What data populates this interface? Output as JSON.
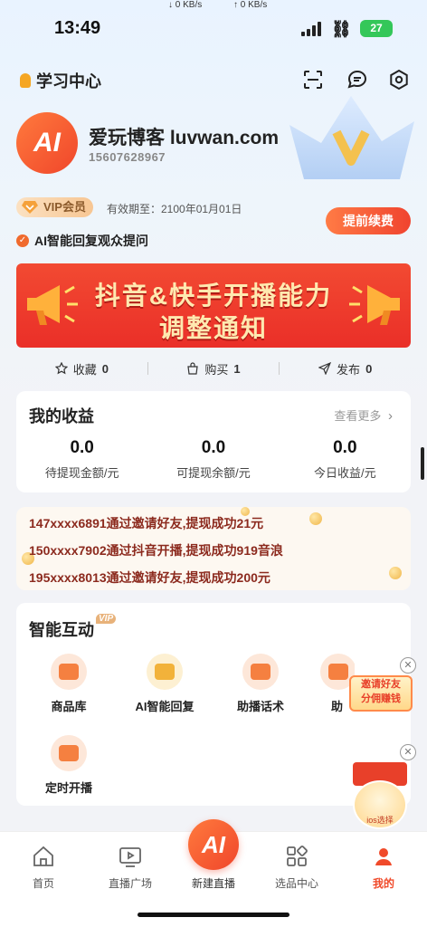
{
  "status_bar": {
    "time": "13:49",
    "down_speed": "↓ 0 KB/s",
    "up_speed": "↑ 0 KB/s",
    "battery": "27"
  },
  "header": {
    "title": "学习中心",
    "icons": [
      "scan-icon",
      "message-icon",
      "settings-icon"
    ]
  },
  "profile": {
    "avatar_text": "AI",
    "name": "爱玩博客 luvwan.com",
    "phone": "15607628967",
    "vip_label": "VIP会员",
    "vip_expiry": "有效期至：2100年01月01日",
    "renew_label": "提前续费",
    "ai_reply": "AI智能回复观众提问"
  },
  "banner": {
    "line1": "抖音&快手开播能力",
    "line2": "调整通知"
  },
  "stats": [
    {
      "label": "收藏",
      "value": "0",
      "icon": "star-icon"
    },
    {
      "label": "购买",
      "value": "1",
      "icon": "bag-icon"
    },
    {
      "label": "发布",
      "value": "0",
      "icon": "send-icon"
    }
  ],
  "earnings": {
    "title": "我的收益",
    "more": "查看更多",
    "items": [
      {
        "value": "0.0",
        "label": "待提现金额/元"
      },
      {
        "value": "0.0",
        "label": "可提现余额/元"
      },
      {
        "value": "0.0",
        "label": "今日收益/元"
      }
    ]
  },
  "ticker": [
    "147xxxx6891通过邀请好友,提现成功21元",
    "150xxxx7902通过抖音开播,提现成功919音浪",
    "195xxxx8013通过邀请好友,提现成功200元"
  ],
  "interaction": {
    "title": "智能互动",
    "vip_tag": "VIP",
    "features": [
      {
        "label": "商品库",
        "icon": "store-icon"
      },
      {
        "label": "AI智能回复",
        "icon": "ai-reply-icon"
      },
      {
        "label": "助播话术",
        "icon": "script-icon"
      },
      {
        "label": "助",
        "icon": "assistant-icon"
      },
      {
        "label": "定时开播",
        "icon": "timer-play-icon"
      }
    ]
  },
  "promos": {
    "invite_line1": "邀请好友",
    "invite_line2": "分佣赚钱",
    "gift_caption": "ios选择"
  },
  "tabbar": {
    "tabs": [
      {
        "label": "首页",
        "icon": "home-icon"
      },
      {
        "label": "直播广场",
        "icon": "live-square-icon"
      },
      {
        "label": "新建直播",
        "icon": "ai-logo-icon"
      },
      {
        "label": "选品中心",
        "icon": "grid-icon"
      },
      {
        "label": "我的",
        "icon": "profile-icon"
      }
    ],
    "center_text": "AI"
  },
  "colors": {
    "accent": "#f0462b",
    "vip_gold": "#f7c693",
    "ticker_text": "#8c2a1e"
  }
}
